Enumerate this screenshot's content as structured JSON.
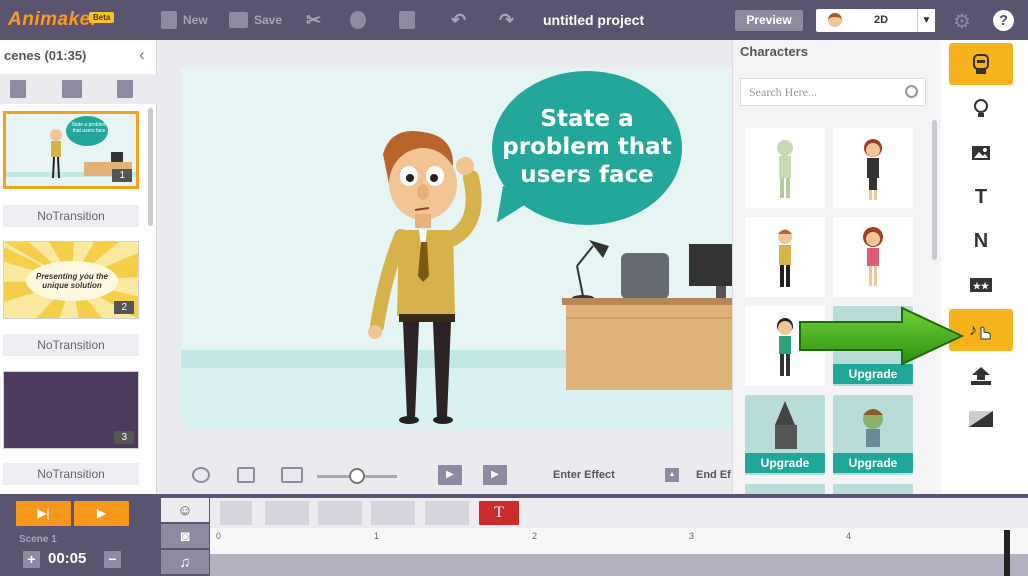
{
  "app": {
    "logo": "Animaker",
    "beta": "Beta",
    "title": "untitled project",
    "new_label": "New",
    "save_label": "Save",
    "preview_label": "Preview",
    "mode_value": "2D",
    "help_label": "?"
  },
  "scenes": {
    "header": "cenes (01:35)",
    "items": [
      {
        "num": "1",
        "transition": "NoTransition"
      },
      {
        "num": "2",
        "transition": "NoTransition",
        "caption": "Presenting you the unique solution"
      },
      {
        "num": "3",
        "transition": "NoTransition"
      }
    ],
    "mini_bubble": "State a problem that users face"
  },
  "stage": {
    "bubble_text": "State a problem that users face",
    "enter_effect": "Enter Effect",
    "end_effect": "End Ef"
  },
  "characters": {
    "header": "Characters",
    "search_placeholder": "Search Here...",
    "upgrade_label": "Upgrade"
  },
  "rail": {
    "text_tool": "T",
    "nosy_tool": "N"
  },
  "timeline": {
    "scene_label": "Scene 1",
    "time": "00:05",
    "plus": "+",
    "minus": "−",
    "ticks": [
      "0",
      "1",
      "2",
      "3",
      "4"
    ],
    "text_item": "T"
  },
  "colors": {
    "topbar": "#5a5470",
    "accent_orange": "#f7981d",
    "accent_yellow": "#f7b31c",
    "teal": "#24a79b",
    "upgrade_teal": "#1fa899",
    "arrow_green": "#3aa614"
  }
}
